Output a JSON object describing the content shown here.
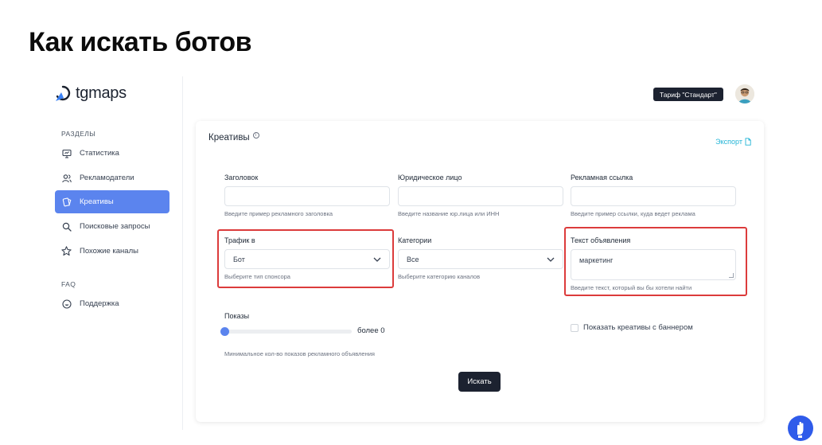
{
  "slide": {
    "title": "Как искать ботов"
  },
  "app": {
    "logo_text": "tgmaps",
    "sidebar": {
      "section1": "РАЗДЕЛЫ",
      "items": [
        {
          "label": "Статистика",
          "icon": "monitor-icon"
        },
        {
          "label": "Рекламодатели",
          "icon": "users-icon"
        },
        {
          "label": "Креативы",
          "icon": "cards-icon",
          "active": true
        },
        {
          "label": "Поисковые запросы",
          "icon": "search-icon"
        },
        {
          "label": "Похожие каналы",
          "icon": "star-icon"
        }
      ],
      "section2": "FAQ",
      "support": {
        "label": "Поддержка",
        "icon": "smile-icon"
      }
    },
    "topbar": {
      "plan_badge": "Тариф \"Стандарт\""
    },
    "card": {
      "title": "Креативы",
      "export": "Экспорт",
      "fields": {
        "headline": {
          "label": "Заголовок",
          "value": "",
          "hint": "Введите пример рекламного заголовка"
        },
        "legal": {
          "label": "Юридическое лицо",
          "value": "",
          "hint": "Введите название юр.лица или ИНН"
        },
        "link": {
          "label": "Рекламная ссылка",
          "value": "",
          "hint": "Введите пример ссылки, куда ведет реклама"
        },
        "traffic": {
          "label": "Трафик в",
          "value": "Бот",
          "hint": "Выберите тип спонсора"
        },
        "categories": {
          "label": "Категории",
          "value": "Все",
          "hint": "Выберите категорию каналов"
        },
        "ad_text": {
          "label": "Текст объявления",
          "value": "маркетинг",
          "hint": "Введите текст, который вы бы хотели найти"
        }
      },
      "views": {
        "label": "Показы",
        "value_text": "более 0",
        "hint": "Минимальное кол-во показов рекламного объявления"
      },
      "banner_checkbox": {
        "label": "Показать креативы с баннером",
        "checked": false
      },
      "search_button": "Искать"
    }
  },
  "colors": {
    "accent": "#5b84ee",
    "dark": "#1c2230",
    "highlight": "#dc3b3b",
    "link": "#22b4d6"
  }
}
